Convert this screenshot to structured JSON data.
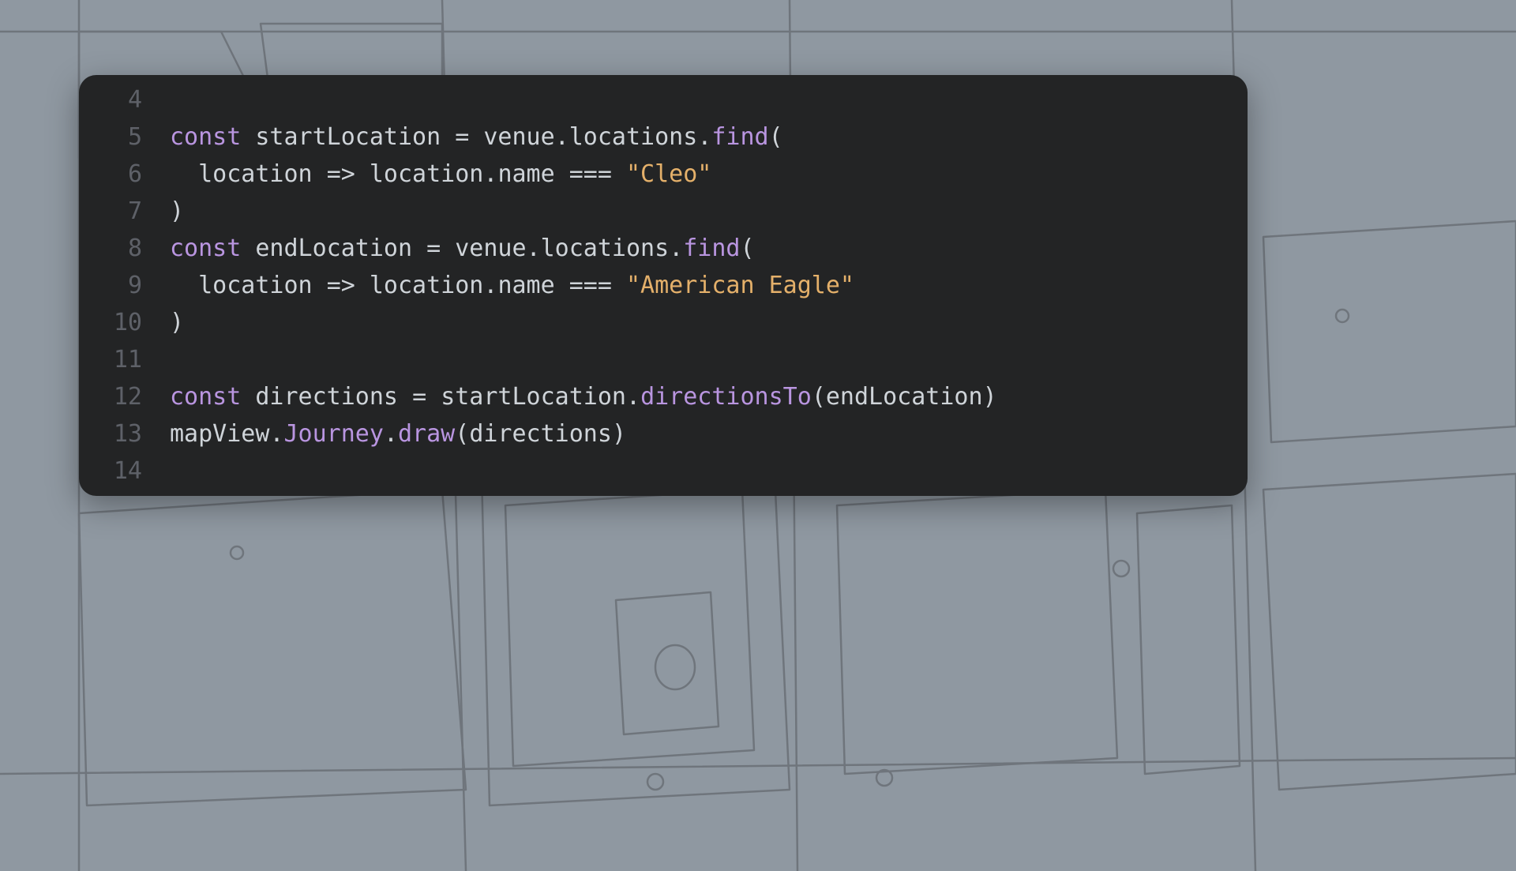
{
  "colors": {
    "background": "#8f98a1",
    "code_bg": "#232425",
    "line_number": "#5e6168",
    "text": "#cfd4d9",
    "keyword": "#b995e0",
    "method": "#b995e0",
    "string": "#e4b06a"
  },
  "code": {
    "start_line_number": 4,
    "lines": [
      {
        "n": 4,
        "tokens": []
      },
      {
        "n": 5,
        "tokens": [
          {
            "t": "kw",
            "v": "const "
          },
          {
            "t": "var",
            "v": "startLocation "
          },
          {
            "t": "op",
            "v": "= "
          },
          {
            "t": "var",
            "v": "venue"
          },
          {
            "t": "op",
            "v": "."
          },
          {
            "t": "var",
            "v": "locations"
          },
          {
            "t": "op",
            "v": "."
          },
          {
            "t": "call",
            "v": "find"
          },
          {
            "t": "callw",
            "v": "("
          }
        ]
      },
      {
        "n": 6,
        "tokens": [
          {
            "t": "op",
            "v": "  "
          },
          {
            "t": "var",
            "v": "location "
          },
          {
            "t": "op",
            "v": "=> "
          },
          {
            "t": "var",
            "v": "location"
          },
          {
            "t": "op",
            "v": "."
          },
          {
            "t": "var",
            "v": "name "
          },
          {
            "t": "op",
            "v": "=== "
          },
          {
            "t": "str",
            "v": "\"Cleo\""
          }
        ]
      },
      {
        "n": 7,
        "tokens": [
          {
            "t": "callw",
            "v": ")"
          }
        ]
      },
      {
        "n": 8,
        "tokens": [
          {
            "t": "kw",
            "v": "const "
          },
          {
            "t": "var",
            "v": "endLocation "
          },
          {
            "t": "op",
            "v": "= "
          },
          {
            "t": "var",
            "v": "venue"
          },
          {
            "t": "op",
            "v": "."
          },
          {
            "t": "var",
            "v": "locations"
          },
          {
            "t": "op",
            "v": "."
          },
          {
            "t": "call",
            "v": "find"
          },
          {
            "t": "callw",
            "v": "("
          }
        ]
      },
      {
        "n": 9,
        "tokens": [
          {
            "t": "op",
            "v": "  "
          },
          {
            "t": "var",
            "v": "location "
          },
          {
            "t": "op",
            "v": "=> "
          },
          {
            "t": "var",
            "v": "location"
          },
          {
            "t": "op",
            "v": "."
          },
          {
            "t": "var",
            "v": "name "
          },
          {
            "t": "op",
            "v": "=== "
          },
          {
            "t": "str",
            "v": "\"American Eagle\""
          }
        ]
      },
      {
        "n": 10,
        "tokens": [
          {
            "t": "callw",
            "v": ")"
          }
        ]
      },
      {
        "n": 11,
        "tokens": []
      },
      {
        "n": 12,
        "tokens": [
          {
            "t": "kw",
            "v": "const "
          },
          {
            "t": "var",
            "v": "directions "
          },
          {
            "t": "op",
            "v": "= "
          },
          {
            "t": "var",
            "v": "startLocation"
          },
          {
            "t": "op",
            "v": "."
          },
          {
            "t": "call",
            "v": "directionsTo"
          },
          {
            "t": "callw",
            "v": "("
          },
          {
            "t": "var",
            "v": "endLocation"
          },
          {
            "t": "callw",
            "v": ")"
          }
        ]
      },
      {
        "n": 13,
        "tokens": [
          {
            "t": "var",
            "v": "mapView"
          },
          {
            "t": "op",
            "v": "."
          },
          {
            "t": "journ",
            "v": "Journey"
          },
          {
            "t": "op",
            "v": "."
          },
          {
            "t": "call",
            "v": "draw"
          },
          {
            "t": "callw",
            "v": "("
          },
          {
            "t": "var",
            "v": "directions"
          },
          {
            "t": "callw",
            "v": ")"
          }
        ]
      },
      {
        "n": 14,
        "tokens": []
      }
    ]
  }
}
